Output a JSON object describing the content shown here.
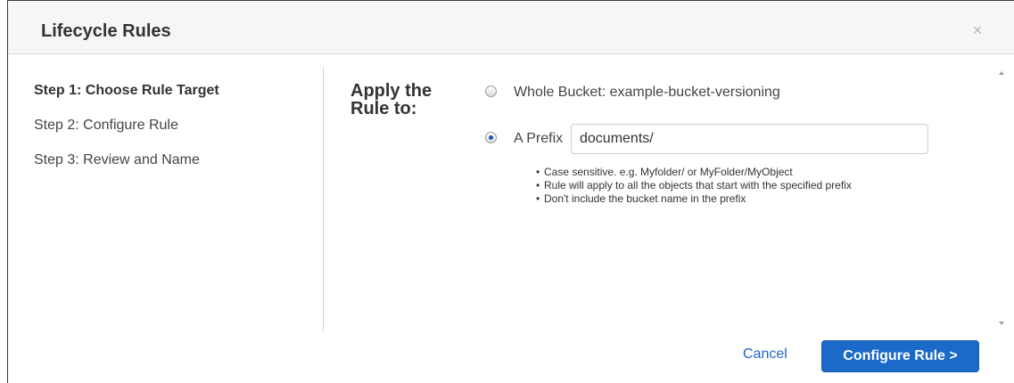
{
  "dialog": {
    "title": "Lifecycle Rules",
    "close_glyph": "×"
  },
  "steps": [
    {
      "label": "Step 1: Choose Rule Target",
      "active": true
    },
    {
      "label": "Step 2: Configure Rule",
      "active": false
    },
    {
      "label": "Step 3: Review and Name",
      "active": false
    }
  ],
  "target": {
    "heading_line1": "Apply the",
    "heading_line2": "Rule to:",
    "options": [
      {
        "label": "Whole Bucket: example-bucket-versioning",
        "selected": false
      },
      {
        "label": "A Prefix",
        "selected": true
      }
    ],
    "prefix_value": "documents/",
    "hints": [
      "Case sensitive. e.g. Myfolder/ or MyFolder/MyObject",
      "Rule will apply to all the objects that start with the specified prefix",
      "Don't include the bucket name in the prefix"
    ]
  },
  "footer": {
    "cancel_label": "Cancel",
    "primary_label": "Configure Rule >"
  },
  "colors": {
    "accent": "#1b6ac9",
    "link": "#1f66c2",
    "header_bg": "#f6f6f6"
  },
  "icons": {
    "close": "close-icon",
    "radio_unchecked": "radio-unchecked-icon",
    "radio_checked": "radio-checked-icon"
  }
}
